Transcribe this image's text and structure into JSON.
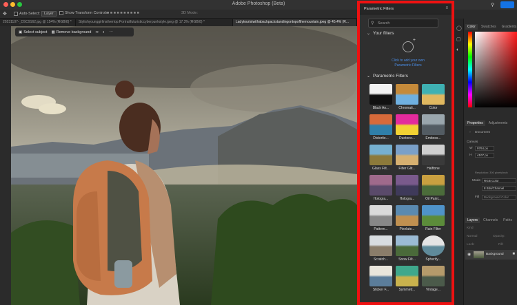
{
  "app": {
    "title": "Adobe Photoshop (Beta)"
  },
  "options": {
    "auto_select": "Auto-Select:",
    "layer_dropdown": "Layer",
    "show_transform": "Show Transform Controls",
    "mode_3d": "3D Mode:"
  },
  "tabs": [
    "20231107-_DSC9162.jpg @ 154% (RGB/8) *",
    "Stylishyounggirlinsilvertop.Portraitfuturisticcyberpunkstyle.jpeg @ 17.3% (RGB/8) *",
    "Ladytouristwithabackpackstandingontopofthemountain.jpeg @ 45.4% (R..."
  ],
  "ctx": {
    "select_subject": "Select subject",
    "remove_background": "Remove background"
  },
  "filters_panel": {
    "title": "Parametric Filters",
    "search_placeholder": "Search",
    "your_filters": "Your filters",
    "add_text_line1": "Click to add your own",
    "add_text_line2": "Parametric Filters",
    "section": "Parametric Filters",
    "items": [
      "Black An...",
      "Chromati...",
      "Color",
      "Distortio...",
      "Duotone...",
      "Emboss...",
      "Glass Filt...",
      "Filter Glit...",
      "Halftone",
      "Hologra...",
      "Hologra...",
      "Oil Paint...",
      "Pattern...",
      "Pixelate...",
      "Rain Filter",
      "Scratch...",
      "Snow Filt...",
      "Spherify...",
      "Sticker F...",
      "Symmetr...",
      "Vintage..."
    ]
  },
  "right": {
    "tab_color": "Color",
    "tab_swatches": "Swatches",
    "tab_gradients": "Gradients",
    "tab_properties": "Properties",
    "tab_adjustments": "Adjustments",
    "document": "Document",
    "canvas": "Canvas",
    "w_label": "W",
    "w_value": "9764 px",
    "h_label": "H",
    "h_value": "4107 px",
    "resolution": "Resolution: 300 pixels/inch",
    "mode_label": "Mode",
    "mode_value": "RGB Color",
    "bits_value": "8 Bits/Channel",
    "fill_label": "Fill",
    "fill_value": "Background Color",
    "tab_layers": "Layers",
    "tab_channels": "Channels",
    "tab_paths": "Paths",
    "kind": "Kind",
    "normal": "Normal",
    "opacity": "Opacity:",
    "lock": "Lock:",
    "fill2": "Fill:",
    "layer_name": "Background"
  },
  "colors": {
    "accent": "#1473e6",
    "highlight": "#ee1111"
  }
}
